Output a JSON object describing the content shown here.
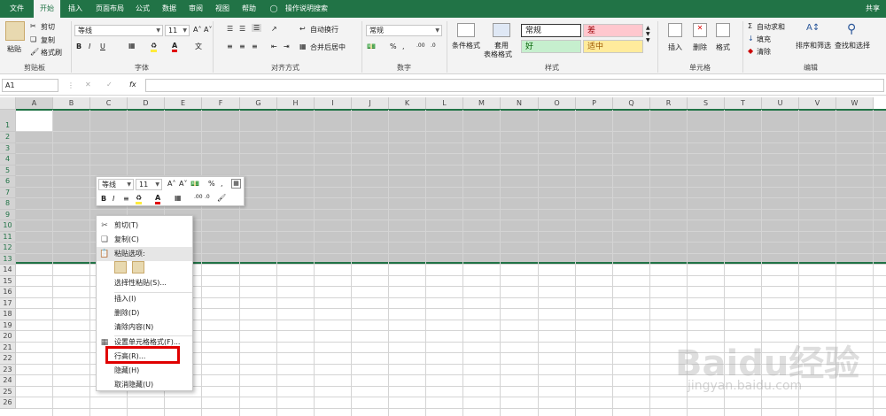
{
  "tabs": [
    "文件",
    "开始",
    "插入",
    "页面布局",
    "公式",
    "数据",
    "审阅",
    "视图",
    "帮助",
    "操作说明搜索",
    "共享"
  ],
  "ribbon": {
    "clipboard": {
      "paste": "粘贴",
      "cut": "剪切",
      "copy": "复制",
      "format_painter": "格式刷",
      "label": "剪贴板"
    },
    "font": {
      "name": "等线",
      "size": "11",
      "label": "字体"
    },
    "alignment": {
      "wrap": "自动换行",
      "merge": "合并后居中",
      "label": "对齐方式"
    },
    "number": {
      "format": "常规",
      "label": "数字"
    },
    "styles": {
      "conditional": "条件格式",
      "table": "套用",
      "table2": "表格格式",
      "normal": "常规",
      "bad": "差",
      "good": "好",
      "neutral": "适中",
      "label": "样式"
    },
    "cells": {
      "insert": "插入",
      "delete": "删除",
      "format": "格式",
      "label": "单元格"
    },
    "editing": {
      "autosum": "自动求和",
      "fill": "填充",
      "clear": "清除",
      "sort": "排序和筛选",
      "find": "查找和选择",
      "label": "编辑"
    }
  },
  "formula_bar": {
    "name_box": "A1",
    "fx": "fx"
  },
  "columns": [
    "A",
    "B",
    "C",
    "D",
    "E",
    "F",
    "G",
    "H",
    "I",
    "J",
    "K",
    "L",
    "M",
    "N",
    "O",
    "P",
    "Q",
    "R",
    "S",
    "T",
    "U",
    "V",
    "W"
  ],
  "rows": [
    "1",
    "2",
    "3",
    "4",
    "5",
    "6",
    "7",
    "8",
    "9",
    "10",
    "11",
    "12",
    "13",
    "14",
    "15",
    "16",
    "17",
    "18",
    "19",
    "20",
    "21",
    "22",
    "23",
    "24",
    "25",
    "26"
  ],
  "mini_toolbar": {
    "font": "等线",
    "size": "11",
    "percent": "%"
  },
  "context_menu": [
    {
      "label": "剪切(T)",
      "icon": "scissors-icon"
    },
    {
      "label": "复制(C)",
      "icon": "copy-icon"
    },
    {
      "label": "粘贴选项:",
      "icon": "paste-icon"
    },
    {
      "label": "选择性粘贴(S)...",
      "icon": ""
    },
    {
      "label": "插入(I)",
      "icon": ""
    },
    {
      "label": "删除(D)",
      "icon": ""
    },
    {
      "label": "清除内容(N)",
      "icon": ""
    },
    {
      "label": "设置单元格格式(F)...",
      "icon": "format-cells-icon"
    },
    {
      "label": "行高(R)...",
      "icon": ""
    },
    {
      "label": "隐藏(H)",
      "icon": ""
    },
    {
      "label": "取消隐藏(U)",
      "icon": ""
    }
  ],
  "watermark": {
    "text": "Baidu经验",
    "url": "jingyan.baidu.com"
  },
  "colors": {
    "excel_green": "#217346",
    "selection": "#c6c6c6",
    "highlight": "#e00000"
  }
}
